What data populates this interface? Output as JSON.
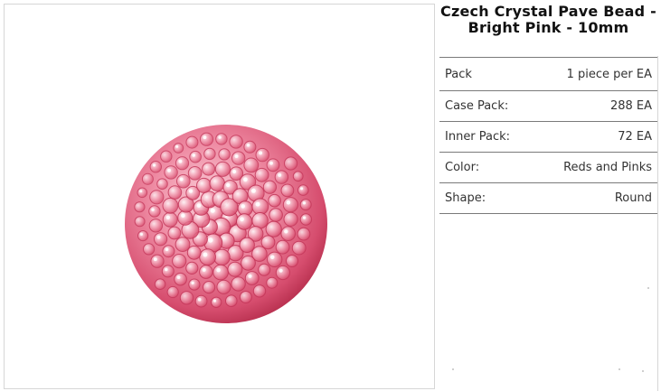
{
  "product": {
    "title": "Czech Crystal Pave Bead - Bright Pink - 10mm",
    "image_alt": "Pink crystal pave bead"
  },
  "specs": [
    {
      "label": "Pack",
      "value": "1 piece per EA"
    },
    {
      "label": "Case Pack:",
      "value": "288 EA"
    },
    {
      "label": "Inner Pack:",
      "value": "72 EA"
    },
    {
      "label": "Color:",
      "value": "Reds and Pinks"
    },
    {
      "label": "Shape:",
      "value": "Round"
    }
  ],
  "colors": {
    "bead_base": "#e9758f",
    "bead_light": "#f8c1ce",
    "bead_dark": "#c23457",
    "divider": "#7a7a7a",
    "frame_border": "#d6d6d6"
  }
}
